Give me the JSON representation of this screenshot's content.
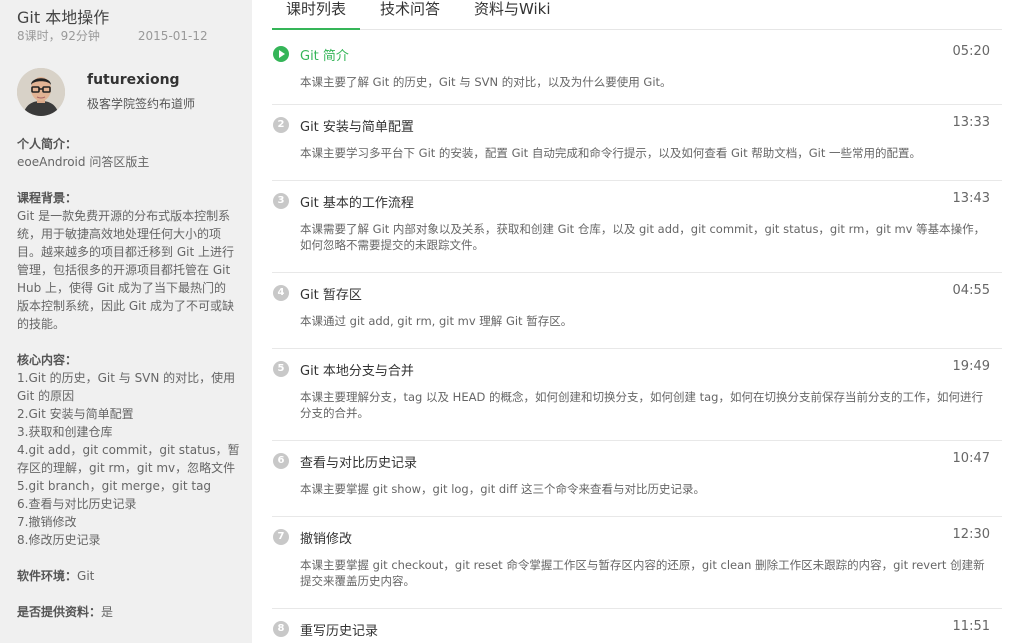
{
  "course": {
    "title": "Git 本地操作",
    "meta": "8课时，92分钟",
    "date": "2015-01-12"
  },
  "author": {
    "name": "futurexiong",
    "role": "极客学院签约布道师"
  },
  "intro": {
    "heading": "个人简介：",
    "text": "eoeAndroid 问答区版主"
  },
  "background": {
    "heading": "课程背景：",
    "lines": [
      "Git 是一款免费开源的分布式版本控制系",
      "统，用于敏捷高效地处理任何大小的项",
      "目。越来越多的项目都迁移到 Git 上进行",
      "管理，包括很多的开源项目都托管在 Git",
      "Hub 上，使得 Git 成为了当下最热门的",
      "版本控制系统，因此 Git 成为了不可或缺",
      "的技能。"
    ]
  },
  "core": {
    "heading": "核心内容：",
    "lines": [
      "1.Git 的历史，Git 与 SVN 的对比，使用",
      "Git 的原因",
      "2.Git 安装与简单配置",
      "3.获取和创建仓库",
      "4.git add，git commit，git status，暂",
      "存区的理解，git rm，git mv，忽略文件",
      "5.git branch，git merge，git tag",
      "6.查看与对比历史记录",
      "7.撤销修改",
      "8.修改历史记录"
    ]
  },
  "env": {
    "heading": "软件环境：",
    "value": "Git"
  },
  "materials": {
    "heading": "是否提供资料：",
    "value": "是"
  },
  "tabs": [
    "课时列表",
    "技术问答",
    "资料与Wiki"
  ],
  "lessons": [
    {
      "num": "",
      "title": "Git 简介",
      "duration": "05:20",
      "desc": "本课主要了解 Git 的历史，Git 与 SVN 的对比，以及为什么要使用 Git。",
      "active": true
    },
    {
      "num": "2",
      "title": "Git 安装与简单配置",
      "duration": "13:33",
      "desc": "本课主要学习多平台下 Git 的安装，配置 Git 自动完成和命令行提示，以及如何查看 Git 帮助文档，Git 一些常用的配置。"
    },
    {
      "num": "3",
      "title": "Git 基本的工作流程",
      "duration": "13:43",
      "desc": "本课需要了解 Git 内部对象以及关系，获取和创建 Git 仓库，以及 git add，git commit，git status，git rm，git mv 等基本操作，如何忽略不需要提交的未跟踪文件。"
    },
    {
      "num": "4",
      "title": "Git 暂存区",
      "duration": "04:55",
      "desc": "本课通过 git add, git rm, git mv 理解 Git 暂存区。"
    },
    {
      "num": "5",
      "title": "Git 本地分支与合并",
      "duration": "19:49",
      "desc": "本课主要理解分支，tag 以及 HEAD 的概念，如何创建和切换分支，如何创建 tag，如何在切换分支前保存当前分支的工作，如何进行分支的合并。"
    },
    {
      "num": "6",
      "title": "查看与对比历史记录",
      "duration": "10:47",
      "desc": "本课主要掌握 git show，git log，git diff 这三个命令来查看与对比历史记录。"
    },
    {
      "num": "7",
      "title": "撤销修改",
      "duration": "12:30",
      "desc": "本课主要掌握 git checkout，git reset 命令掌握工作区与暂存区内容的还原，git clean 删除工作区未跟踪的内容，git revert 创建新提交来覆盖历史内容。"
    },
    {
      "num": "8",
      "title": "重写历史记录",
      "duration": "11:51",
      "desc": ""
    }
  ]
}
